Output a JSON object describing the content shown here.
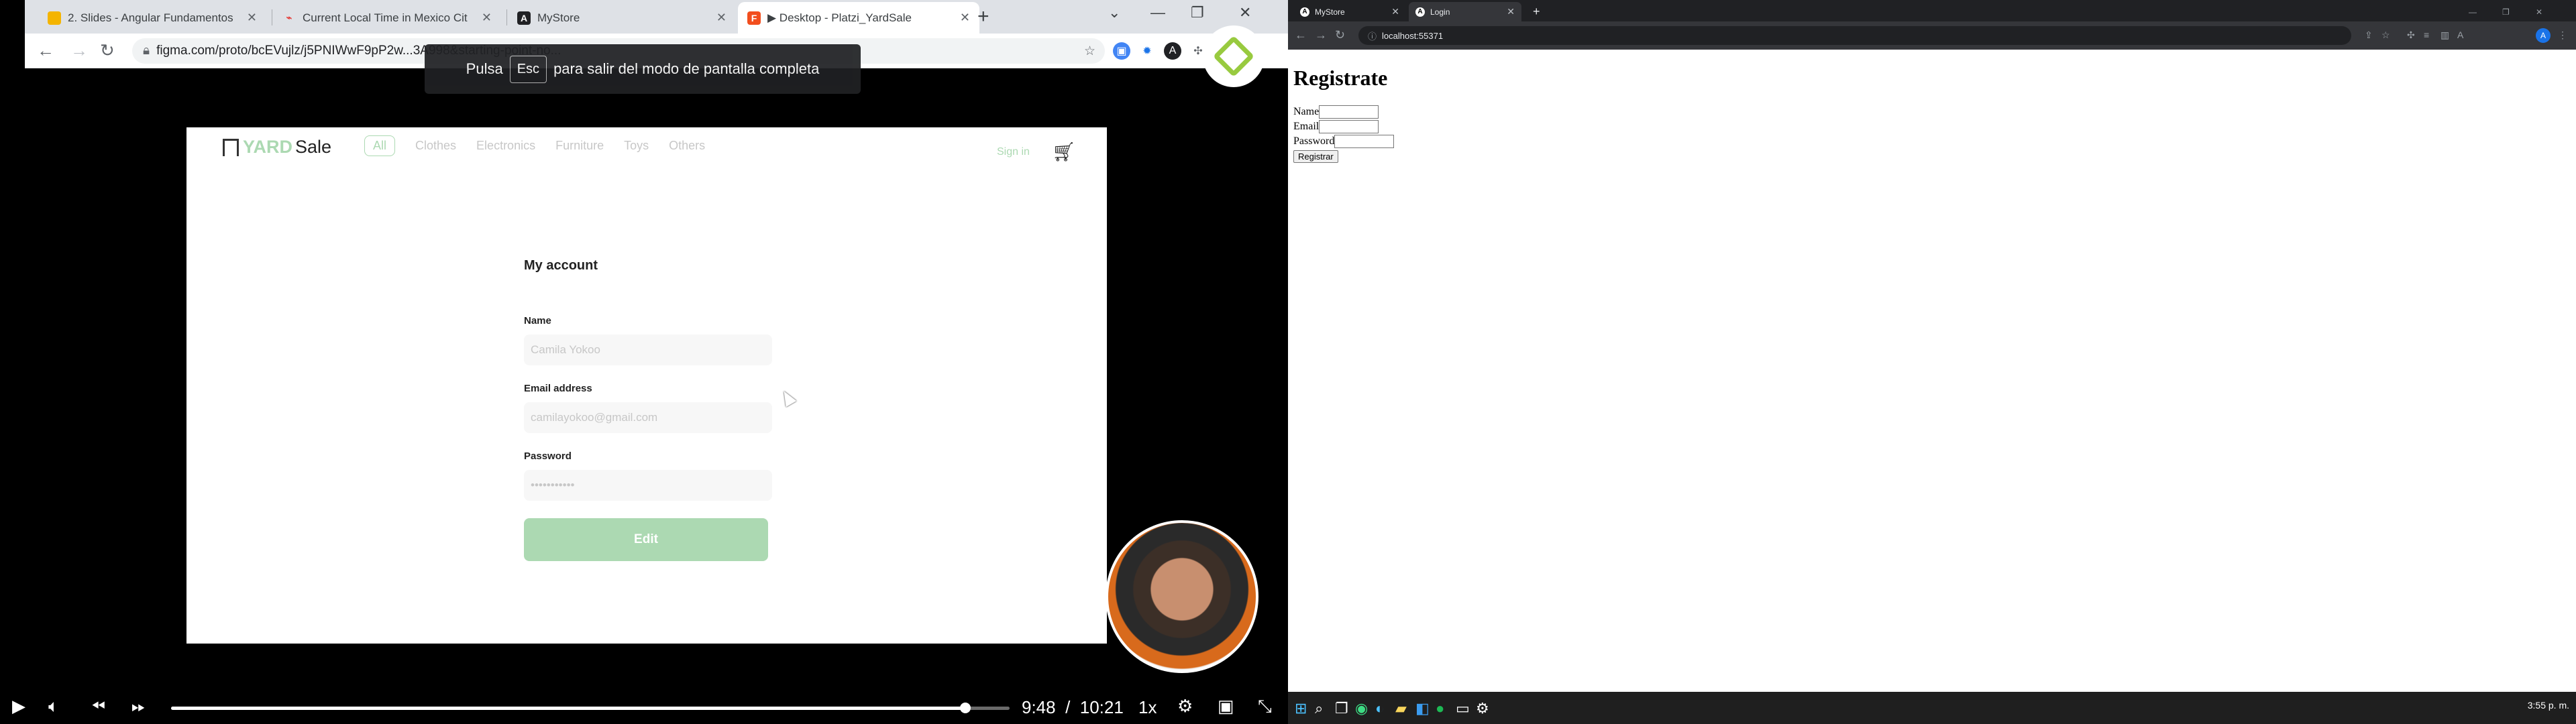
{
  "left": {
    "tabs": [
      {
        "title": "2. Slides - Angular Fundamentos",
        "icon": "slides-icon",
        "color": "#f4b400"
      },
      {
        "title": "Current Local Time in Mexico Cit",
        "icon": "clock-favicon-icon",
        "color": "#e53935"
      },
      {
        "title": "MyStore",
        "icon": "angular-icon",
        "color": "#202124"
      },
      {
        "title": "▶ Desktop - Platzi_YardSale",
        "icon": "figma-icon",
        "color": "#f24e1e"
      }
    ],
    "url": "figma.com/proto/bcEVujlz/j5PNIWwF9pP2w...3A998&starting-point-no...",
    "fullscreen_notice": {
      "prefix": "Pulsa",
      "key": "Esc",
      "suffix": "para salir del modo de pantalla completa"
    },
    "yardsale": {
      "logo_yard": "YARD",
      "logo_sale": "Sale",
      "nav": [
        "All",
        "Clothes",
        "Electronics",
        "Furniture",
        "Toys",
        "Others"
      ],
      "signin": "Sign in",
      "account_title": "My account",
      "fields": [
        {
          "label": "Name",
          "value": "Camila Yokoo"
        },
        {
          "label": "Email address",
          "value": "camilayokoo@gmail.com"
        },
        {
          "label": "Password",
          "value": "•••••••••••"
        }
      ],
      "edit_button": "Edit",
      "accent_color": "#acd9b2"
    },
    "player": {
      "current_time": "9:48",
      "separator": "/",
      "duration": "10:21",
      "rate": "1x",
      "progress_fraction": 0.947
    }
  },
  "right": {
    "tabs": [
      {
        "title": "MyStore",
        "icon": "angular-icon"
      },
      {
        "title": "Login",
        "icon": "angular-icon"
      }
    ],
    "url": "localhost:55371",
    "heading": "Registrate",
    "form": {
      "name_label": "Name",
      "email_label": "Email",
      "password_label": "Password",
      "submit_label": "Registrar"
    },
    "taskbar_time": "3:55 p. m."
  }
}
